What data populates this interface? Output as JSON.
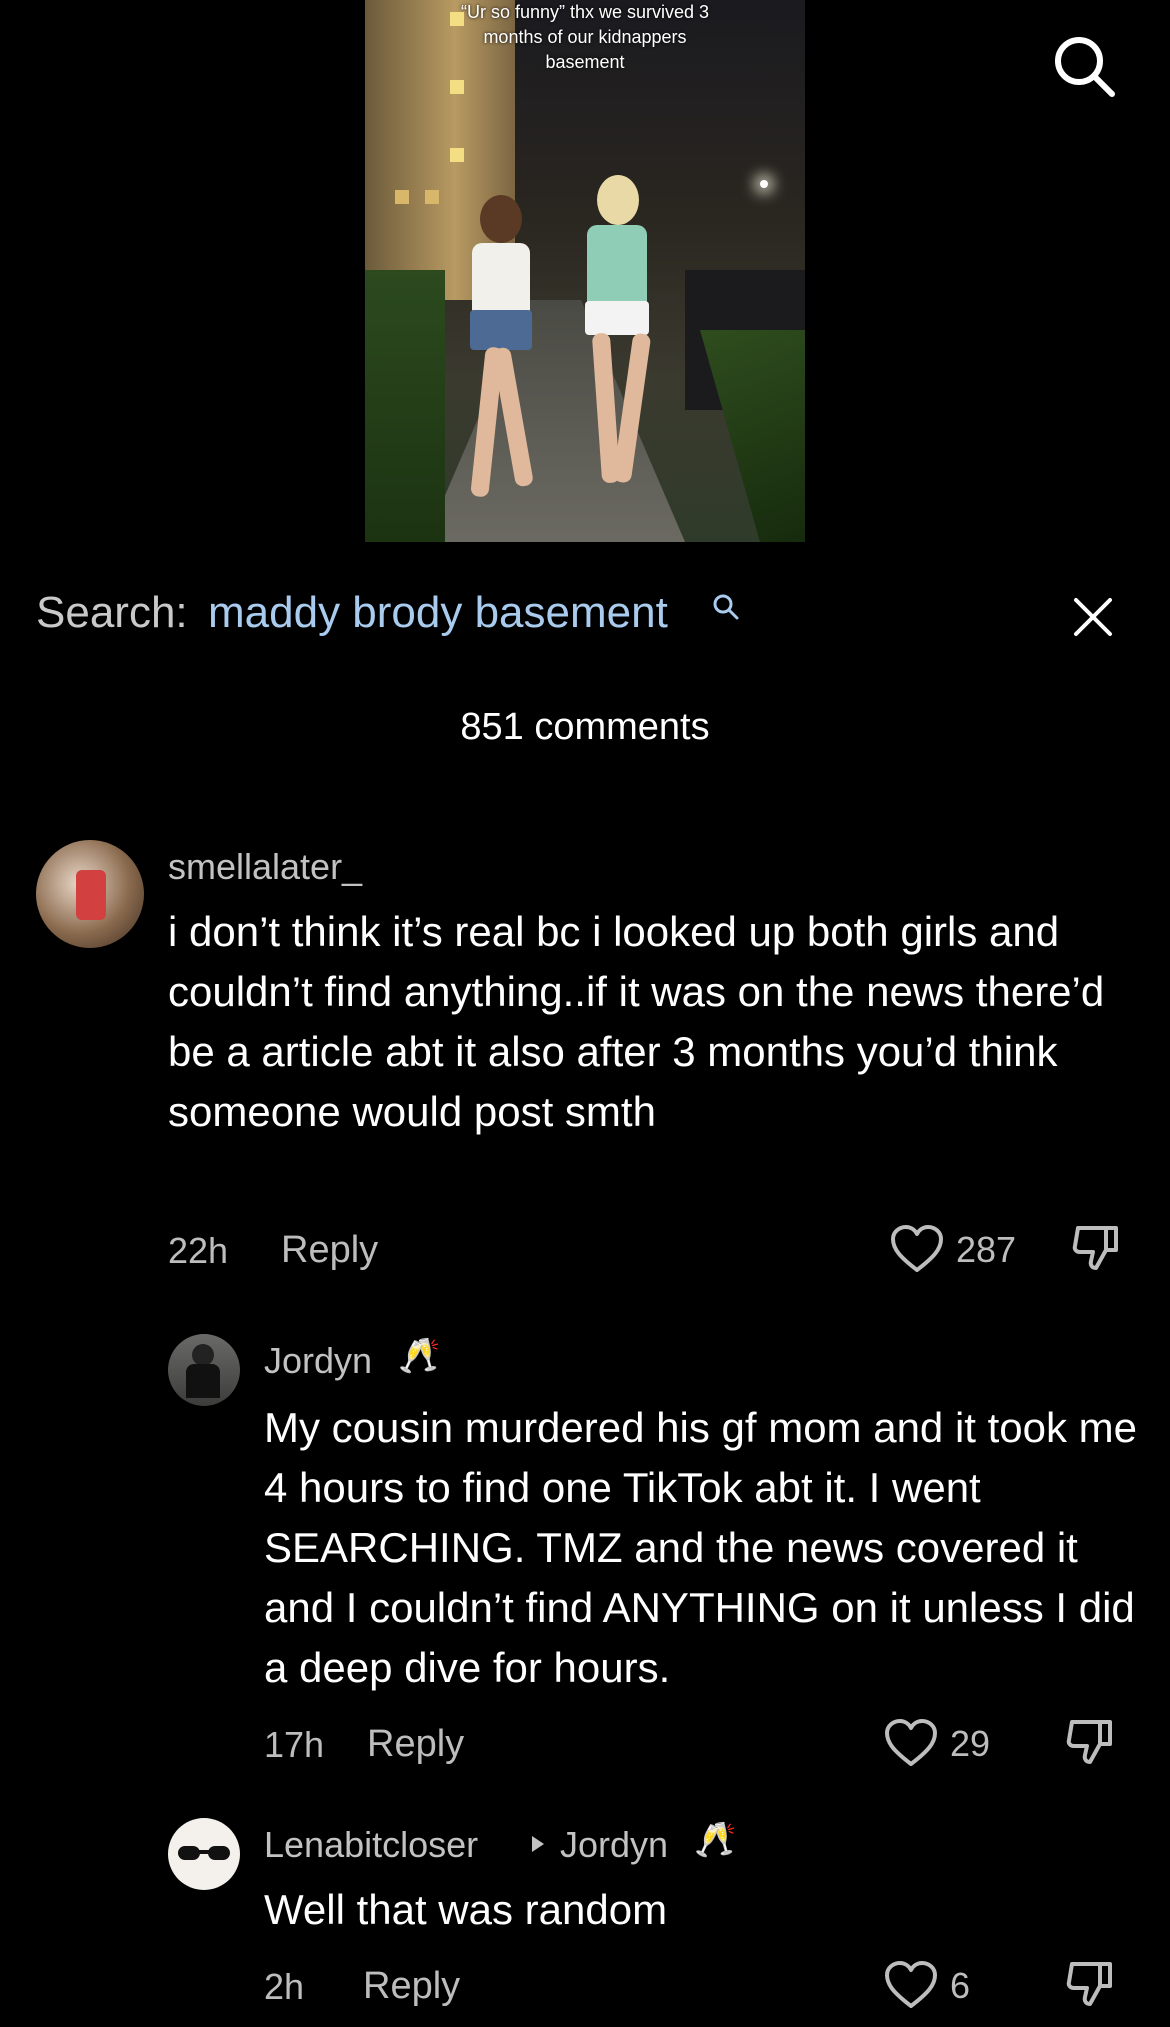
{
  "video": {
    "caption": "“Ur so funny” thx we survived 3 months of our kidnappers basement"
  },
  "search": {
    "label": "Search:",
    "query": "maddy brody basement"
  },
  "comments_header": "851 comments",
  "comments": [
    {
      "username": "smellalater_",
      "text": "i don’t think it’s real bc i looked up both girls and couldn’t find anything..if it was on the news there’d be a article abt it also after 3 months you’d think someone would post smth",
      "time": "22h",
      "reply": "Reply",
      "likes": "287"
    },
    {
      "username": "Jordyn",
      "text": "My cousin murdered his gf mom and it took me 4 hours to find one TikTok abt it. I went SEARCHING. TMZ and the news covered it and I couldn’t find ANYTHING on it unless I did a deep dive for hours.",
      "time": "17h",
      "reply": "Reply",
      "likes": "29"
    },
    {
      "username": "Lenabitcloser",
      "reply_to": "Jordyn",
      "text": "Well that was random",
      "time": "2h",
      "reply": "Reply",
      "likes": "6"
    }
  ],
  "icons": {
    "search": "search-icon",
    "close": "close-icon",
    "like": "heart-icon",
    "dislike": "thumbs-down-icon",
    "emoji": "champagne-icon"
  }
}
